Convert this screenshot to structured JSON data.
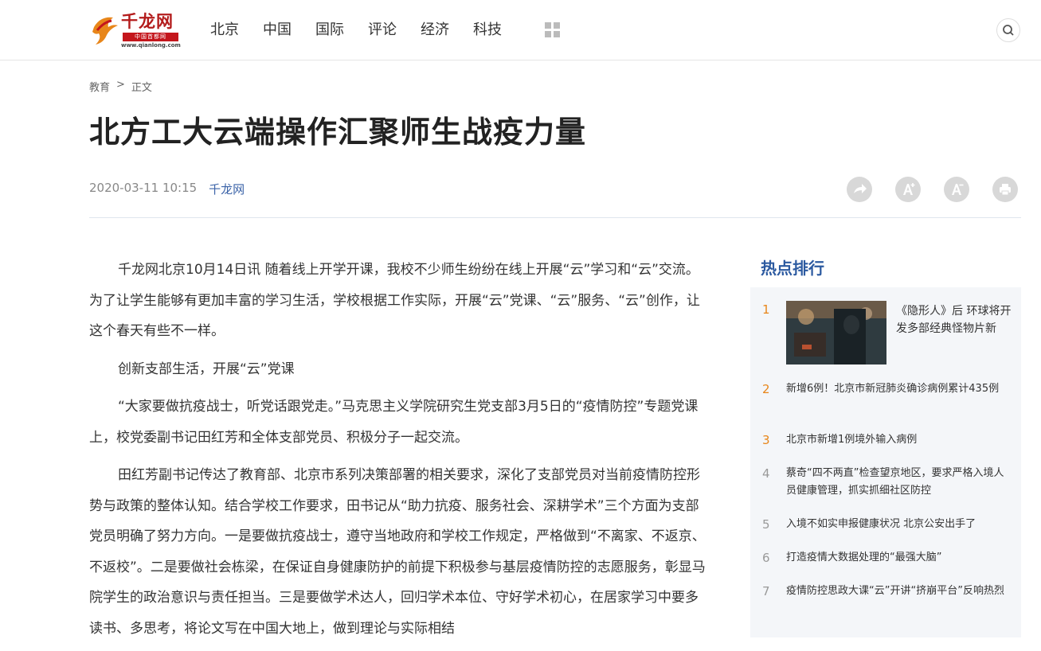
{
  "header": {
    "logo": {
      "brand": "千龙网",
      "tagline": "中国首都网",
      "url": "www.qianlong.com"
    },
    "nav": [
      "北京",
      "中国",
      "国际",
      "评论",
      "经济",
      "科技"
    ],
    "grid_icon": "apps-grid-icon",
    "search_icon": "search-icon"
  },
  "breadcrumb": {
    "section": "教育",
    "separator": ">",
    "current": "正文"
  },
  "article": {
    "title": "北方工大云端操作汇聚师生战疫力量",
    "datetime": "2020-03-11 10:15",
    "source": "千龙网",
    "tools": [
      {
        "name": "share-icon",
        "glyph": "➦"
      },
      {
        "name": "font-increase-icon",
        "glyph": "A⁺"
      },
      {
        "name": "font-decrease-icon",
        "glyph": "A⁻"
      },
      {
        "name": "print-icon",
        "glyph": "⎙"
      }
    ],
    "paragraphs": [
      "千龙网北京10月14日讯 随着线上开学开课，我校不少师生纷纷在线上开展“云”学习和“云”交流。为了让学生能够有更加丰富的学习生活，学校根据工作实际，开展“云”党课、“云”服务、“云”创作，让这个春天有些不一样。",
      "创新支部生活，开展“云”党课",
      "“大家要做抗疫战士，听党话跟党走。”马克思主义学院研究生党支部3月5日的“疫情防控”专题党课上，校党委副书记田红芳和全体支部党员、积极分子一起交流。",
      "田红芳副书记传达了教育部、北京市系列决策部署的相关要求，深化了支部党员对当前疫情防控形势与政策的整体认知。结合学校工作要求，田书记从“助力抗疫、服务社会、深耕学术”三个方面为支部党员明确了努力方向。一是要做抗疫战士，遵守当地政府和学校工作规定，严格做到“不离家、不返京、不返校”。二是要做社会栋梁，在保证自身健康防护的前提下积极参与基层疫情防控的志愿服务，彰显马院学生的政治意识与责任担当。三是要做学术达人，回归学术本位、守好学术初心，在居家学习中要多读书、多思考，将论文写在中国大地上，做到理论与实际相结"
    ]
  },
  "sidebar": {
    "title": "热点排行",
    "rank_colors": {
      "top": "#e8861a",
      "rest": "#999999"
    },
    "items": [
      {
        "rank": "1",
        "text": "《隐形人》后 环球将开发多部经典怪物片新"
      },
      {
        "rank": "2",
        "text": "新增6例！北京市新冠肺炎确诊病例累计435例"
      },
      {
        "rank": "3",
        "text": "北京市新增1例境外输入病例"
      },
      {
        "rank": "4",
        "text": "蔡奇“四不两直”检查望京地区，要求严格入境人员健康管理，抓实抓细社区防控"
      },
      {
        "rank": "5",
        "text": "入境不如实申报健康状况 北京公安出手了"
      },
      {
        "rank": "6",
        "text": "打造疫情大数据处理的“最强大脑”"
      },
      {
        "rank": "7",
        "text": "疫情防控思政大课“云”开讲“挤崩平台”反响热烈"
      }
    ]
  }
}
